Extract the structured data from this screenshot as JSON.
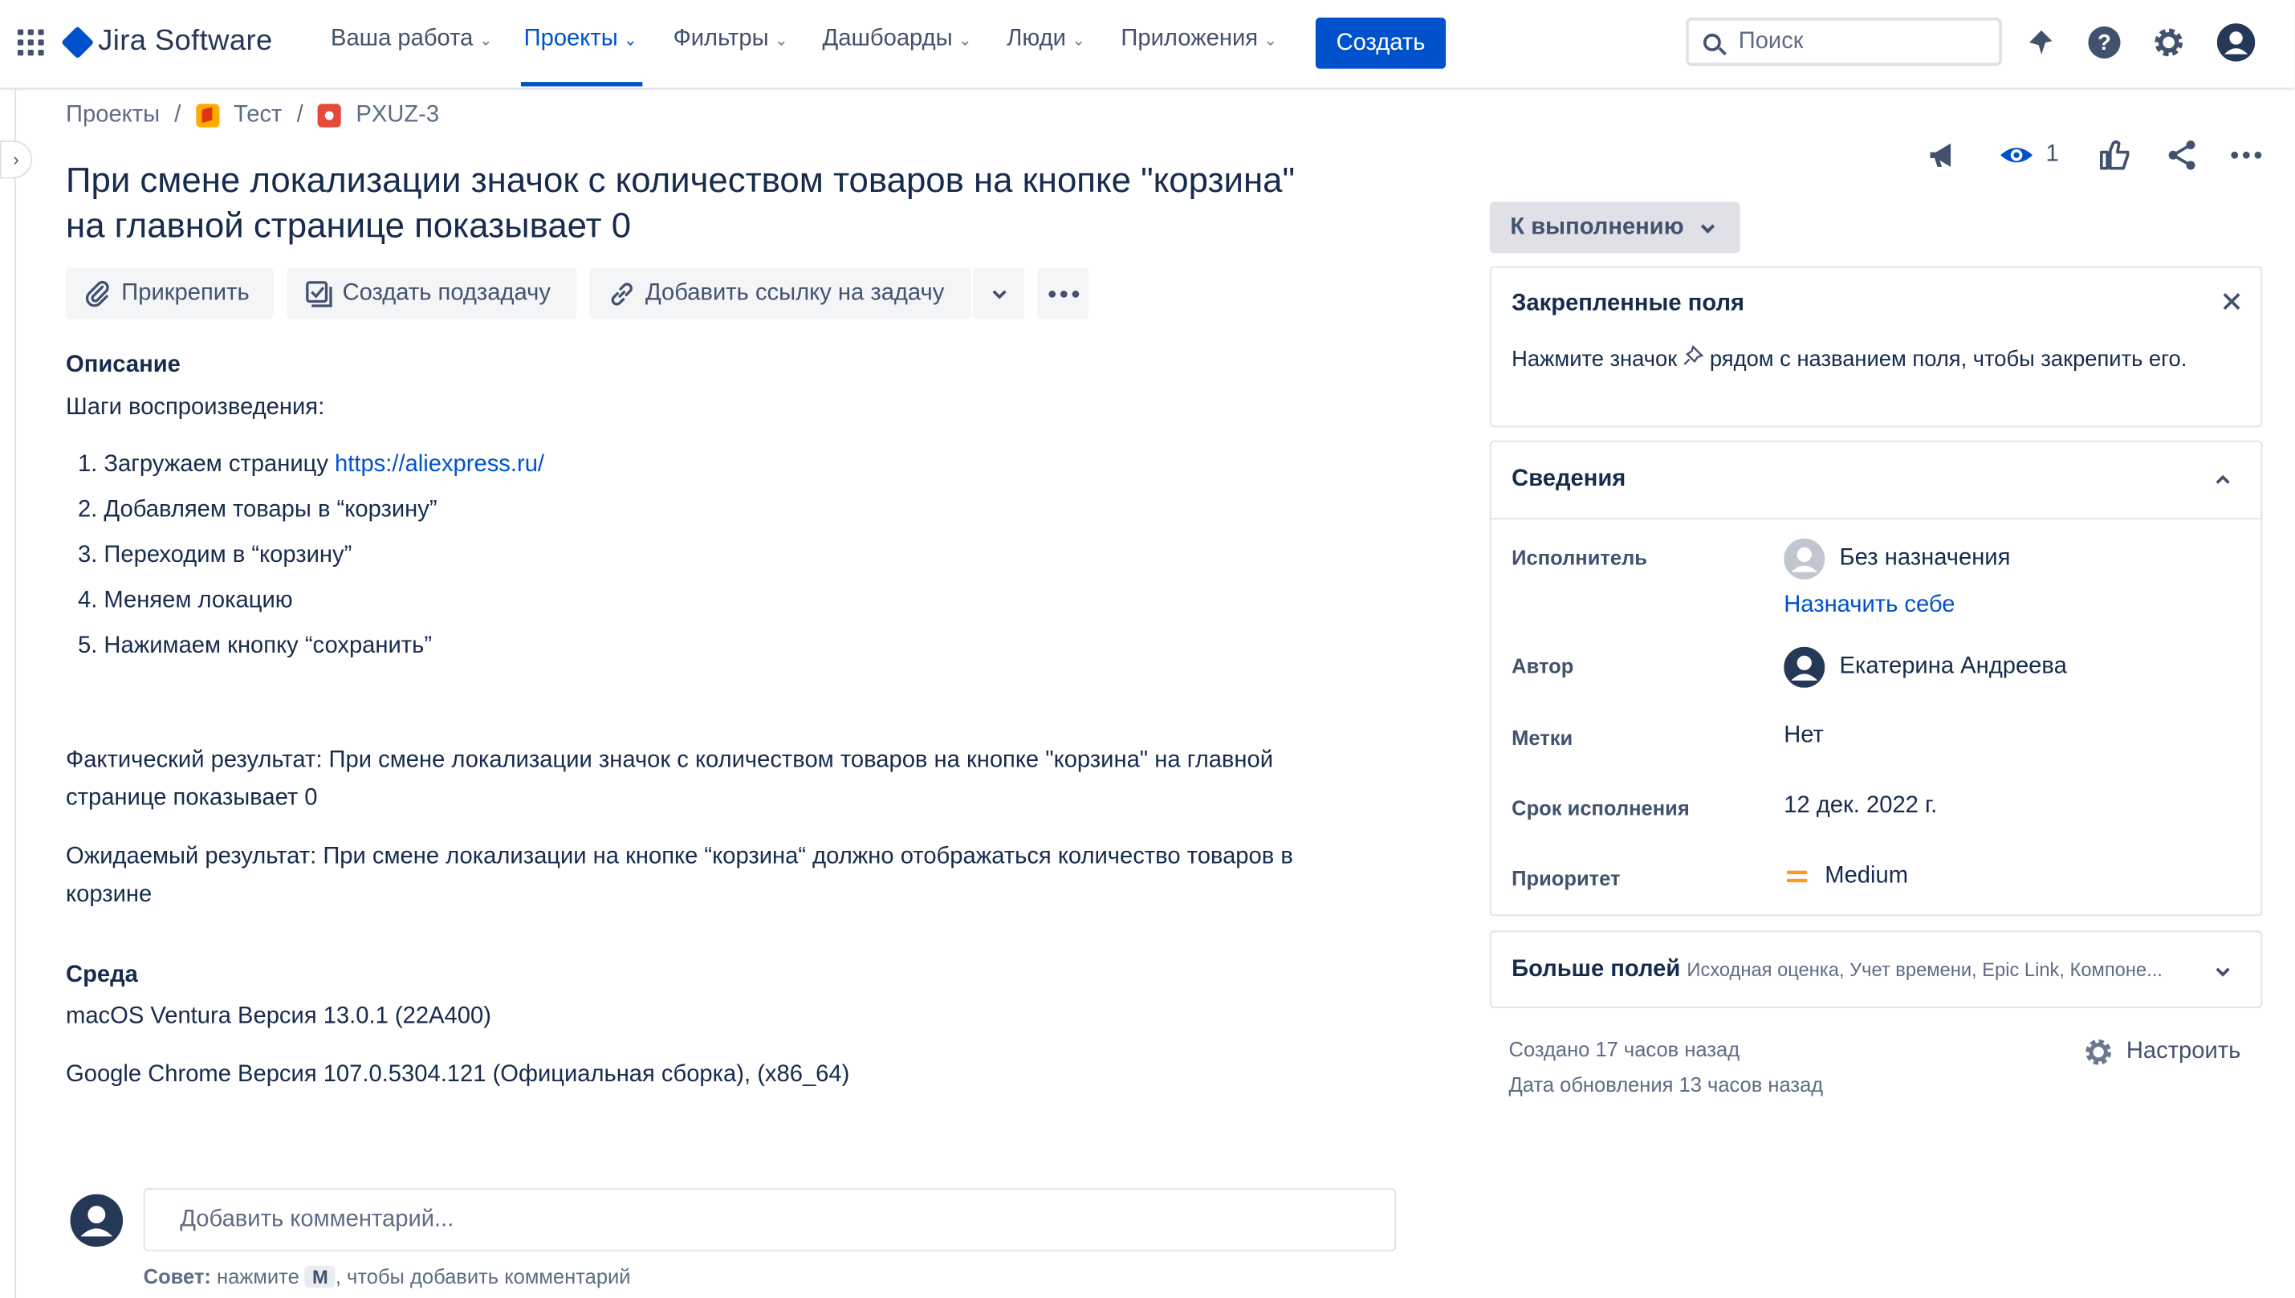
{
  "nav": {
    "logo": "Jira Software",
    "items": [
      {
        "label": "Ваша работа"
      },
      {
        "label": "Проекты"
      },
      {
        "label": "Фильтры"
      },
      {
        "label": "Дашбоарды"
      },
      {
        "label": "Люди"
      },
      {
        "label": "Приложения"
      }
    ],
    "create": "Создать",
    "search_placeholder": "Поиск",
    "accent": "#0052CC"
  },
  "breadcrumb": {
    "projects": "Проекты",
    "project": "Тест",
    "issue_key": "PXUZ-3"
  },
  "issue": {
    "title": "При смене локализации значок с количеством товаров на кнопке \"корзина\" на главной странице показывает 0",
    "actions": {
      "attach": "Прикрепить",
      "subtask": "Создать подзадачу",
      "link": "Добавить ссылку на задачу"
    },
    "description": {
      "heading": "Описание",
      "steps_intro": "Шаги воспроизведения:",
      "step1_text": "Загружаем страницу ",
      "step1_link": "https://aliexpress.ru/",
      "steps": [
        "Добавляем товары в “корзину”",
        "Переходим в “корзину”",
        "Меняем локацию",
        "Нажимаем кнопку “сохранить”"
      ],
      "actual": "Фактический результат: При смене локализации значок с количеством товаров на кнопке \"корзина\" на главной странице показывает 0",
      "expected": "Ожидаемый результат: При смене локализации на кнопке “корзина“ должно отображаться количество товаров в корзине"
    },
    "environment": {
      "heading": "Среда",
      "os": "macOS Ventura Версия 13.0.1 (22A400)",
      "browser": "Google Chrome Версия 107.0.5304.121 (Официальная сборка), (x86_64)"
    },
    "comment": {
      "placeholder": "Добавить комментарий...",
      "tip_prefix": "Совет:",
      "tip_press": " нажмите ",
      "tip_key": "M",
      "tip_suffix": ", чтобы добавить комментарий"
    }
  },
  "sidebar": {
    "watchers": "1",
    "status": "К выполнению",
    "pinned": {
      "title": "Закрепленные поля",
      "text_before": "Нажмите значок ",
      "text_after": " рядом с названием поля, чтобы закрепить его."
    },
    "details": {
      "title": "Сведения",
      "assignee_label": "Исполнитель",
      "assignee_value": "Без назначения",
      "assign_self": "Назначить себе",
      "reporter_label": "Автор",
      "reporter_value": "Екатерина Андреева",
      "labels_label": "Метки",
      "labels_value": "Нет",
      "due_label": "Срок исполнения",
      "due_value": "12 дек. 2022 г.",
      "priority_label": "Приоритет",
      "priority_value": "Medium",
      "priority_color": "#FF991F"
    },
    "more": {
      "title": "Больше полей",
      "subtitle": "Исходная оценка, Учет времени, Epic Link, Компоне..."
    },
    "created": "Создано 17 часов назад",
    "updated": "Дата обновления 13 часов назад",
    "configure": "Настроить"
  }
}
